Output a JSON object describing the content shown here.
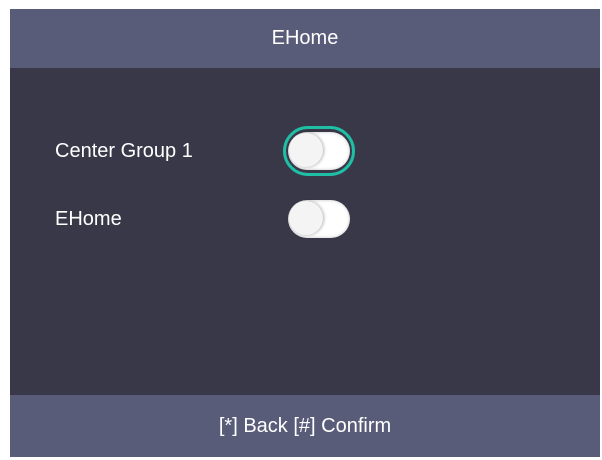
{
  "header": {
    "title": "EHome"
  },
  "settings": {
    "items": [
      {
        "label": "Center Group 1",
        "enabled": false,
        "focused": true
      },
      {
        "label": "EHome",
        "enabled": false,
        "focused": false
      }
    ]
  },
  "footer": {
    "hint": "[*] Back [#] Confirm"
  },
  "colors": {
    "bar": "#595c78",
    "background": "#393848",
    "focus_ring": "#1fbfa6"
  }
}
